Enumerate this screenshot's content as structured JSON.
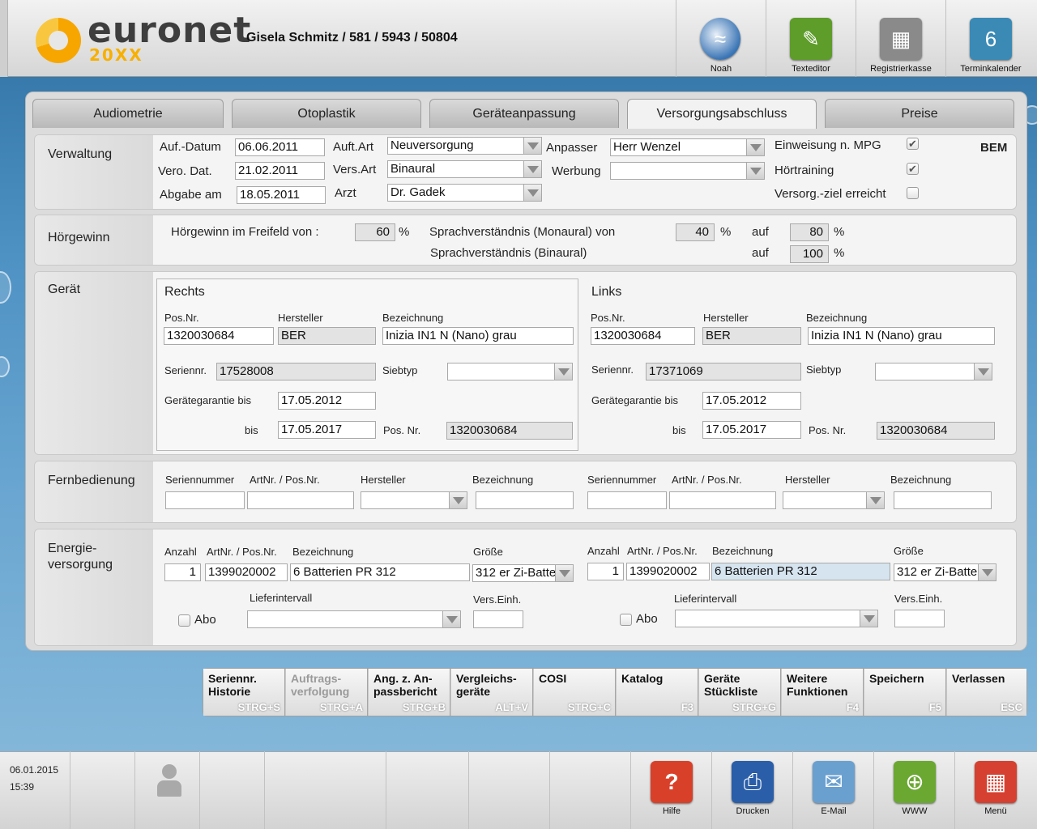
{
  "header": {
    "logo": "euronet",
    "logo_sub": "20XX",
    "patient": "Gisela Schmitz / 581 / 5943 / 50804",
    "buttons": [
      {
        "label": "Noah",
        "icon": "noah-icon",
        "color": "#3a75b5"
      },
      {
        "label": "Texteditor",
        "icon": "pencil-icon",
        "color": "#5e9d2a"
      },
      {
        "label": "Registrierkasse",
        "icon": "cash-register-icon",
        "color": "#8a8a8a"
      },
      {
        "label": "Terminkalender",
        "icon": "calendar-icon",
        "color": "#3a8ab5"
      }
    ]
  },
  "tabs": [
    {
      "label": "Audiometrie"
    },
    {
      "label": "Otoplastik"
    },
    {
      "label": "Geräteanpassung"
    },
    {
      "label": "Versorgungsabschluss",
      "active": true
    },
    {
      "label": "Preise"
    }
  ],
  "verwaltung": {
    "title": "Verwaltung",
    "auf_datum_label": "Auf.-Datum",
    "auf_datum": "06.06.2011",
    "vero_label": "Vero. Dat.",
    "vero": "21.02.2011",
    "abgabe_label": "Abgabe am",
    "abgabe": "18.05.2011",
    "auftart_label": "Auft.Art",
    "auftart": "Neuversorgung",
    "versart_label": "Vers.Art",
    "versart": "Binaural",
    "arzt_label": "Arzt",
    "arzt": "Dr. Gadek",
    "anpasser_label": "Anpasser",
    "anpasser": "Herr Wenzel",
    "werbung_label": "Werbung",
    "werbung": "",
    "einweisung_label": "Einweisung n. MPG",
    "einweisung": true,
    "hoertraining_label": "Hörtraining",
    "hoertraining": true,
    "versorg_label": "Versorg.-ziel erreicht",
    "versorg": false,
    "bem": "BEM"
  },
  "hoergewinn": {
    "title": "Hörgewinn",
    "freifeld_label": "Hörgewinn im Freifeld von :",
    "freifeld": "60",
    "pct": "%",
    "mono_label": "Sprachverständnis (Monaural) von",
    "mono_von": "40",
    "auf": "auf",
    "mono_auf": "80",
    "bin_label": "Sprachverständnis (Binaural)",
    "bin_auf": "100"
  },
  "geraet": {
    "title": "Gerät",
    "posnr_label": "Pos.Nr.",
    "hersteller_label": "Hersteller",
    "bezeichnung_label": "Bezeichnung",
    "seriennr_label": "Seriennr.",
    "siebtyp_label": "Siebtyp",
    "garantie_label": "Gerätegarantie bis",
    "bis_label": "bis",
    "posnr2_label": "Pos. Nr.",
    "rechts": {
      "title": "Rechts",
      "posnr": "1320030684",
      "hersteller": "BER",
      "bezeichnung": "Inizia IN1 N (Nano) grau",
      "seriennr": "17528008",
      "siebtyp": "",
      "garantie": "17.05.2012",
      "bis": "17.05.2017",
      "posnr2": "1320030684"
    },
    "links": {
      "title": "Links",
      "posnr": "1320030684",
      "hersteller": "BER",
      "bezeichnung": "Inizia IN1 N (Nano) grau",
      "seriennr": "17371069",
      "siebtyp": "",
      "garantie": "17.05.2012",
      "bis": "17.05.2017",
      "posnr2": "1320030684"
    }
  },
  "fernbedienung": {
    "title": "Fernbedienung",
    "seriennummer_label": "Seriennummer",
    "artnr_label": "ArtNr. / Pos.Nr.",
    "hersteller_label": "Hersteller",
    "bezeichnung_label": "Bezeichnung"
  },
  "energie": {
    "title_1": "Energie-",
    "title_2": "versorgung",
    "anzahl_label": "Anzahl",
    "artnr_label": "ArtNr. / Pos.Nr.",
    "bezeichnung_label": "Bezeichnung",
    "groesse_label": "Größe",
    "liefer_label": "Lieferintervall",
    "verseinh_label": "Vers.Einh.",
    "abo_label": "Abo",
    "rechts": {
      "anzahl": "1",
      "artnr": "1399020002",
      "bezeichnung": "6 Batterien PR 312",
      "groesse": "312 er Zi-Batterie",
      "liefer": "",
      "verseinh": ""
    },
    "links": {
      "anzahl": "1",
      "artnr": "1399020002",
      "bezeichnung": "6 Batterien PR 312",
      "groesse": "312 er Zi-Batterie",
      "liefer": "",
      "verseinh": ""
    }
  },
  "functions": [
    {
      "label": "Seriennr.\nHistorie",
      "key": "STRG+S"
    },
    {
      "label": "Auftrags-\nverfolgung",
      "key": "STRG+A",
      "disabled": true
    },
    {
      "label": "Ang. z. An-\npassbericht",
      "key": "STRG+B"
    },
    {
      "label": "Vergleichs-\ngeräte",
      "key": "ALT+V"
    },
    {
      "label": "COSI",
      "key": "STRG+C"
    },
    {
      "label": "Katalog",
      "key": "F3"
    },
    {
      "label": "Geräte\nStückliste",
      "key": "STRG+G"
    },
    {
      "label": "Weitere\nFunktionen",
      "key": "F4"
    },
    {
      "label": "Speichern",
      "key": "F5"
    },
    {
      "label": "Verlassen",
      "key": "ESC"
    }
  ],
  "status": {
    "date": "06.01.2015",
    "time": "15:39"
  },
  "bottom_buttons": [
    {
      "label": "Hilfe",
      "icon": "help-icon",
      "color": "#d9402a"
    },
    {
      "label": "Drucken",
      "icon": "printer-icon",
      "color": "#2a5ea8"
    },
    {
      "label": "E-Mail",
      "icon": "mail-icon",
      "color": "#6aa0d0"
    },
    {
      "label": "WWW",
      "icon": "globe-icon",
      "color": "#6aa832"
    },
    {
      "label": "Menü",
      "icon": "menu-grid-icon",
      "color": "#d64030"
    }
  ]
}
